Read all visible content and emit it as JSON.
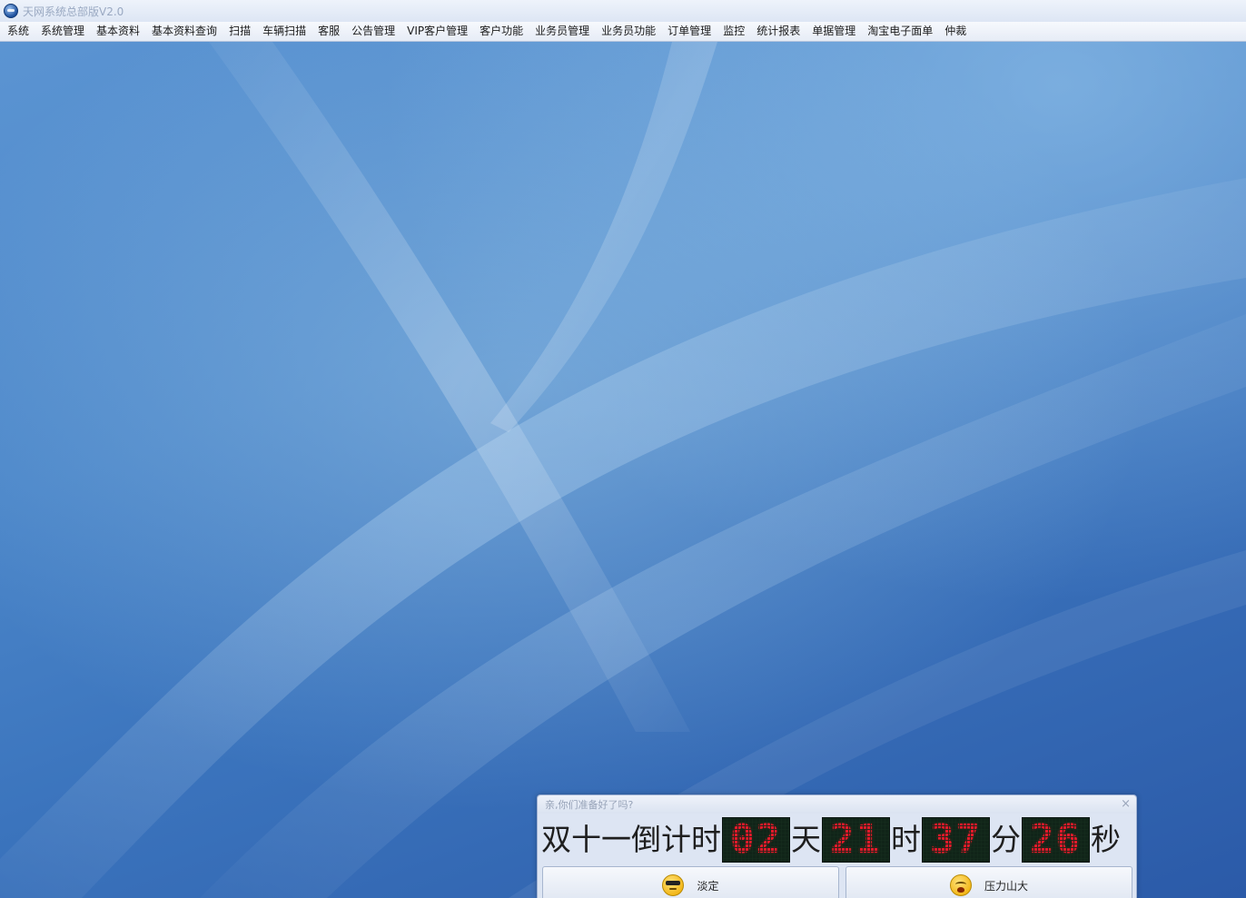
{
  "window": {
    "title": "天网系统总部版V2.0"
  },
  "menu": {
    "items": [
      {
        "label": "系统"
      },
      {
        "label": "系统管理"
      },
      {
        "label": "基本资料"
      },
      {
        "label": "基本资料查询"
      },
      {
        "label": "扫描"
      },
      {
        "label": "车辆扫描"
      },
      {
        "label": "客服"
      },
      {
        "label": "公告管理"
      },
      {
        "label": "VIP客户管理"
      },
      {
        "label": "客户功能"
      },
      {
        "label": "业务员管理"
      },
      {
        "label": "业务员功能"
      },
      {
        "label": "订单管理"
      },
      {
        "label": "监控"
      },
      {
        "label": "统计报表"
      },
      {
        "label": "单据管理"
      },
      {
        "label": "淘宝电子面单"
      },
      {
        "label": "仲裁"
      }
    ]
  },
  "popup": {
    "title": "亲,你们准备好了吗?",
    "close_glyph": "×",
    "countdown": {
      "prefix": "双十一倒计时",
      "days": "02",
      "days_unit": "天",
      "hours": "21",
      "hours_unit": "时",
      "minutes": "37",
      "minutes_unit": "分",
      "seconds": "26",
      "seconds_unit": "秒"
    },
    "buttons": {
      "calm_label": "淡定",
      "calm_icon": "cool-face-icon",
      "stress_label": "压力山大",
      "stress_icon": "stressed-face-icon"
    }
  },
  "colors": {
    "led_digit": "#e21a2a",
    "led_background": "#102418",
    "desktop_blue": "#3b74bd"
  }
}
